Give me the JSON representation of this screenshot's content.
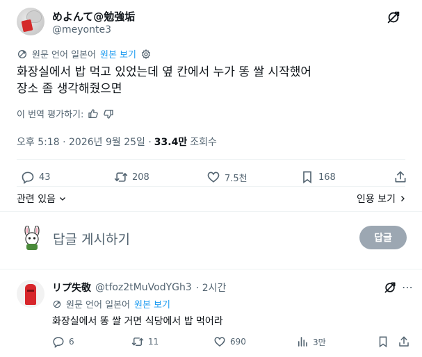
{
  "main_tweet": {
    "author_name": "めよんて@勉強垢",
    "author_handle": "@meyonte3",
    "translate_note": "원문 언어 일본어",
    "show_original": "원본 보기",
    "text_line1": "화장실에서 밥 먹고 있었는데 옆 칸에서 누가 똥 쌀 시작했어",
    "text_line2": "장소 좀 생각해줬으면",
    "rate_translation": "이 번역 평가하기:",
    "time": "오후 5:18 · 2026년 9월 25일 ·",
    "views_count": "33.4만",
    "views_label": "조회수",
    "stats": {
      "replies": "43",
      "retweets": "208",
      "likes": "7.5천",
      "bookmarks": "168"
    },
    "related_label": "관련 있음",
    "quotes_label": "인용 보기"
  },
  "composer": {
    "placeholder": "답글 게시하기",
    "button_label": "답글"
  },
  "reply_tweet": {
    "author_name": "リプ失敬",
    "author_handle": "@tfoz2tMuVodYGh3",
    "time": "· 2시간",
    "translate_note": "원문 언어 일본어",
    "show_original": "원본 보기",
    "text": "화장실에서 똥 쌀 거면 식당에서 밥 먹어라",
    "stats": {
      "replies": "6",
      "retweets": "11",
      "likes": "690",
      "views": "3만"
    }
  },
  "icons": {
    "grok": "grok-icon",
    "translate": "translate-icon",
    "settings": "gear-icon",
    "thumbs_up": "thumbs-up-icon",
    "thumbs_down": "thumbs-down-icon",
    "reply": "reply-icon",
    "retweet": "retweet-icon",
    "like": "heart-icon",
    "bookmark": "bookmark-icon",
    "share": "share-icon",
    "views": "views-icon"
  },
  "colors": {
    "link": "#1d9bf0",
    "muted": "#536471",
    "text": "#0f1419",
    "divider": "#eff3f4",
    "reply_button": "#8b98a5"
  }
}
